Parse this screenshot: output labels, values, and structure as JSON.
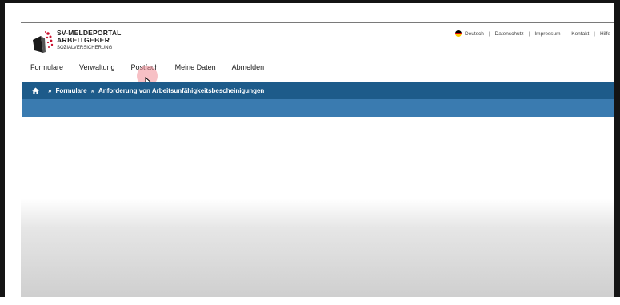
{
  "brand": {
    "line1": "SV-MELDEPORTAL",
    "line2": "ARBEITGEBER",
    "line3": "SOZIALVERSICHERUNG"
  },
  "meta_nav": {
    "language": "Deutsch",
    "links": [
      "Datenschutz",
      "Impressum",
      "Kontakt",
      "Hilfe"
    ]
  },
  "main_nav": {
    "items": [
      "Formulare",
      "Verwaltung",
      "Postfach",
      "Meine Daten",
      "Abmelden"
    ]
  },
  "breadcrumb": {
    "items": [
      "Formulare",
      "Anforderung von Arbeitsunfähigkeitsbescheinigungen"
    ]
  },
  "colors": {
    "breadcrumb_bar": "#1d5b8a",
    "sub_bar": "#3a7bb0"
  }
}
